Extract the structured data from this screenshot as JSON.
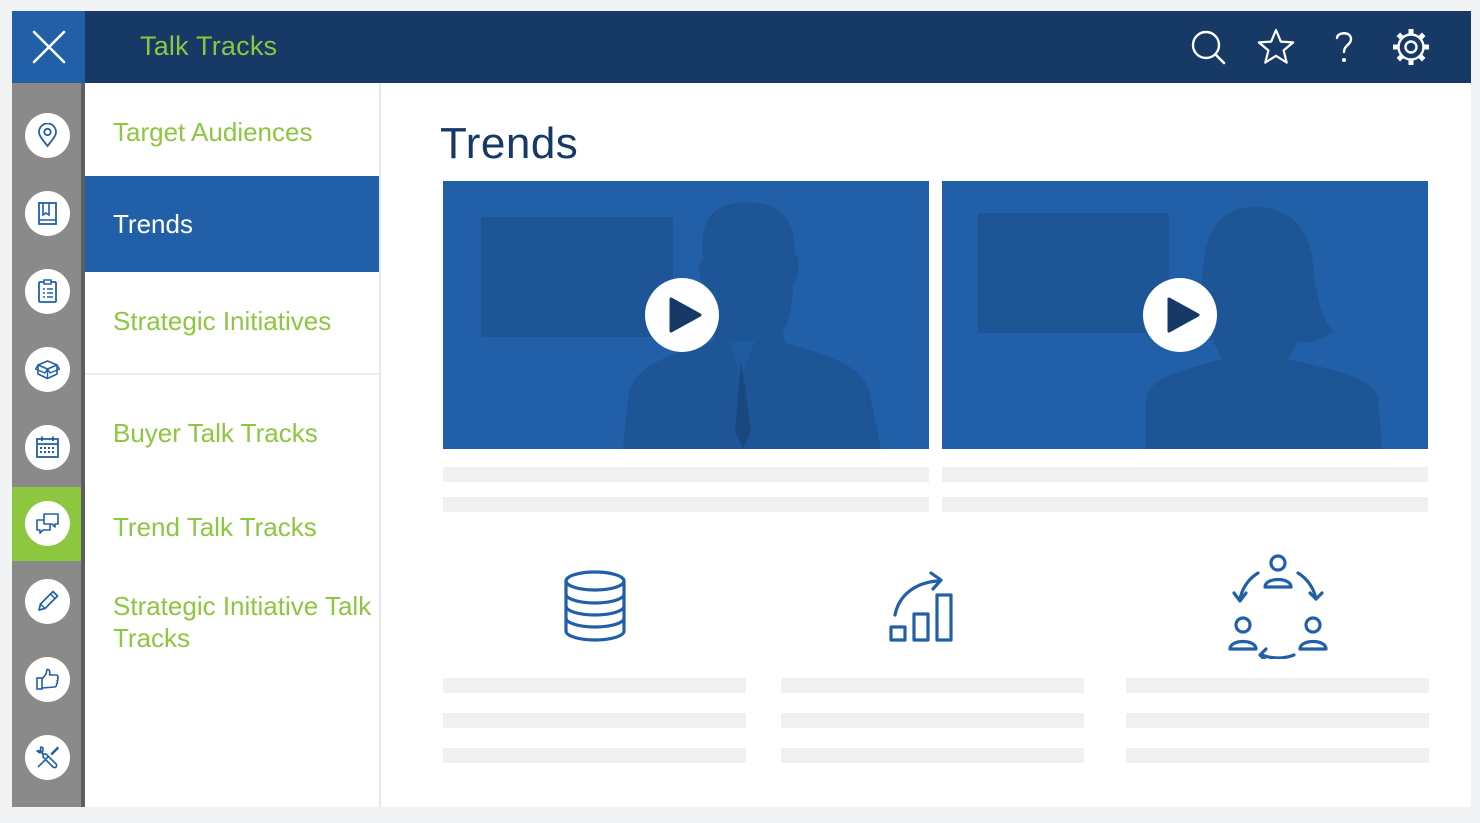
{
  "header": {
    "title": "Talk Tracks",
    "close_icon": "close-icon",
    "actions": [
      "search-icon",
      "star-icon",
      "help-icon",
      "gear-icon"
    ]
  },
  "rail": {
    "items": [
      "location-pin-icon",
      "book-icon",
      "clipboard-list-icon",
      "box-icon",
      "calendar-icon",
      "chat-bubbles-icon",
      "pencil-icon",
      "thumbs-up-icon",
      "tools-icon"
    ],
    "active_index": 5
  },
  "submenu": {
    "items": [
      {
        "label": "Target Audiences"
      },
      {
        "label": "Trends"
      },
      {
        "label": "Strategic Initiatives"
      },
      {
        "label": "Buyer Talk Tracks"
      },
      {
        "label": "Trend Talk Tracks"
      },
      {
        "label": "Strategic Initiative Talk Tracks"
      }
    ],
    "active_index": 1
  },
  "main": {
    "title": "Trends",
    "videos": [
      {
        "subject": "man-silhouette",
        "play_icon": "play-icon"
      },
      {
        "subject": "woman-silhouette",
        "play_icon": "play-icon"
      }
    ],
    "features": [
      "database-icon",
      "growth-chart-icon",
      "team-cycle-icon"
    ]
  },
  "colors": {
    "header_bg": "#163965",
    "accent_blue": "#2160a8",
    "accent_green": "#8dc63f",
    "rail_bg": "#8a8a8a",
    "placeholder": "#eef0f2"
  }
}
